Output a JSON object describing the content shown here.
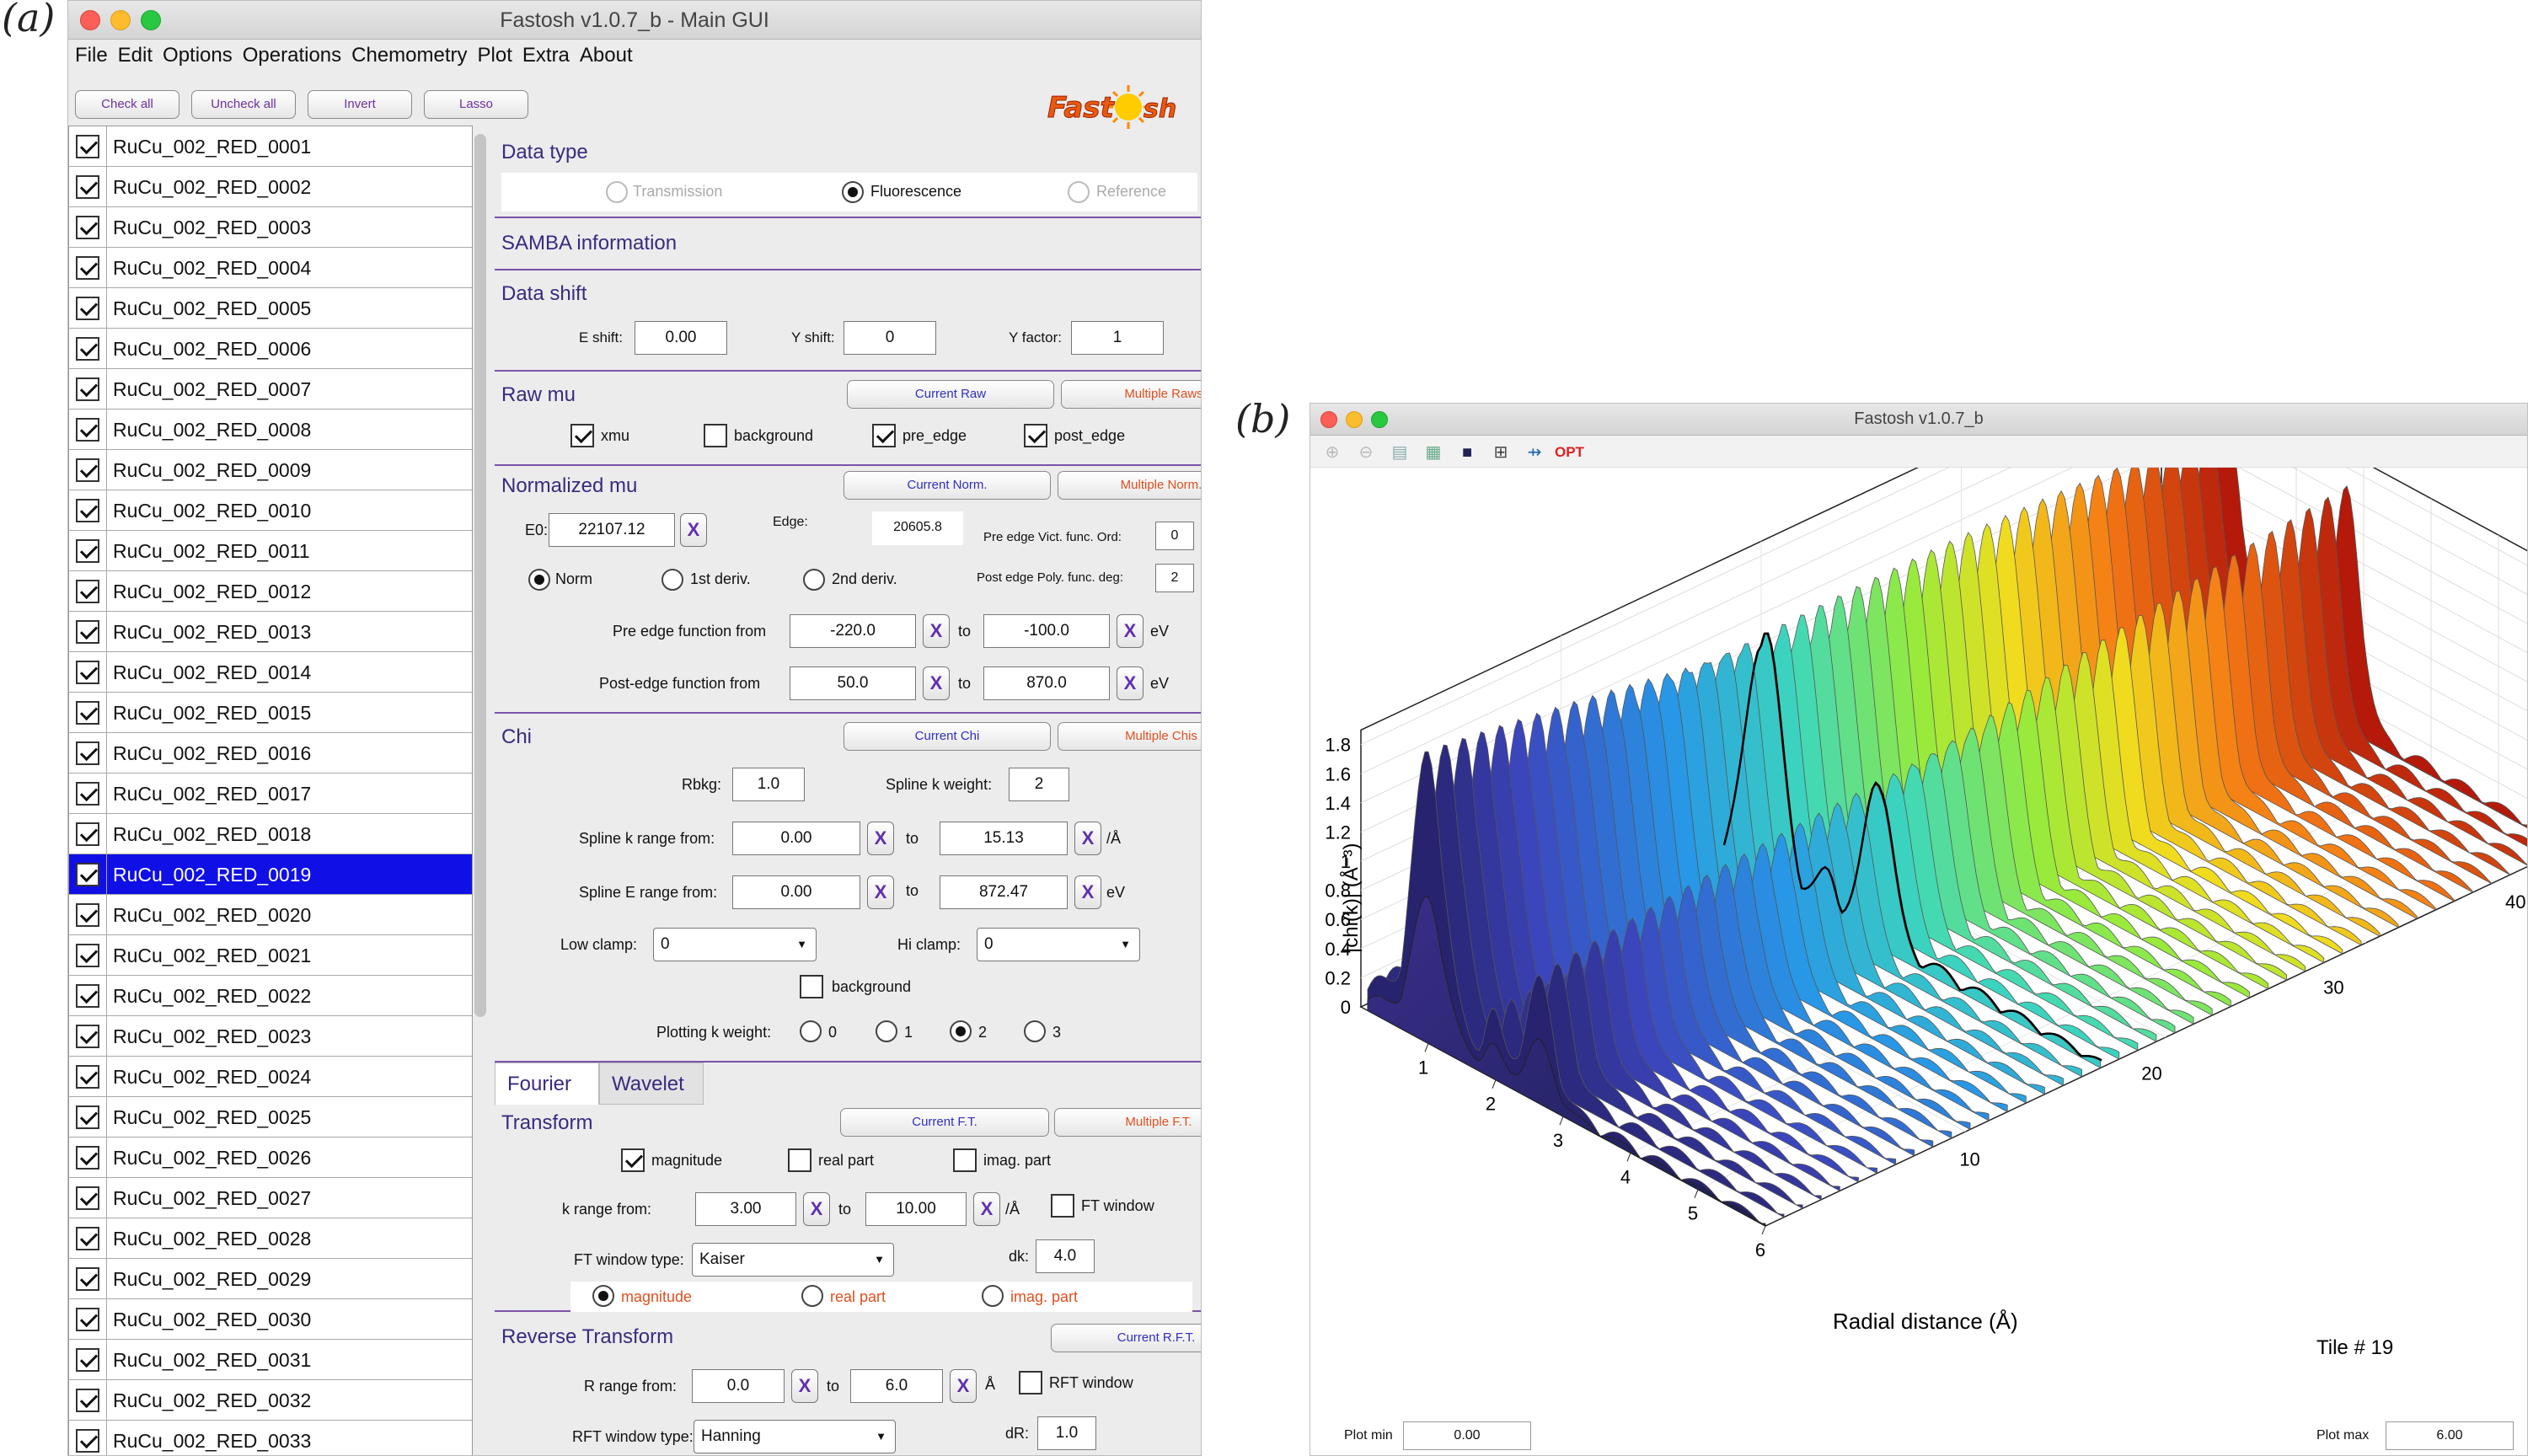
{
  "labels": {
    "a": "(a)",
    "b": "(b)"
  },
  "main": {
    "title": "Fastosh v1.0.7_b - Main GUI",
    "menu": [
      "File",
      "Edit",
      "Options",
      "Operations",
      "Chemometry",
      "Plot",
      "Extra",
      "About"
    ],
    "buttons": {
      "check_all": "Check all",
      "uncheck_all": "Uncheck all",
      "invert": "Invert",
      "lasso": "Lasso"
    },
    "logo": "Fastosh",
    "files": [
      "RuCu_002_RED_0001",
      "RuCu_002_RED_0002",
      "RuCu_002_RED_0003",
      "RuCu_002_RED_0004",
      "RuCu_002_RED_0005",
      "RuCu_002_RED_0006",
      "RuCu_002_RED_0007",
      "RuCu_002_RED_0008",
      "RuCu_002_RED_0009",
      "RuCu_002_RED_0010",
      "RuCu_002_RED_0011",
      "RuCu_002_RED_0012",
      "RuCu_002_RED_0013",
      "RuCu_002_RED_0014",
      "RuCu_002_RED_0015",
      "RuCu_002_RED_0016",
      "RuCu_002_RED_0017",
      "RuCu_002_RED_0018",
      "RuCu_002_RED_0019",
      "RuCu_002_RED_0020",
      "RuCu_002_RED_0021",
      "RuCu_002_RED_0022",
      "RuCu_002_RED_0023",
      "RuCu_002_RED_0024",
      "RuCu_002_RED_0025",
      "RuCu_002_RED_0026",
      "RuCu_002_RED_0027",
      "RuCu_002_RED_0028",
      "RuCu_002_RED_0029",
      "RuCu_002_RED_0030",
      "RuCu_002_RED_0031",
      "RuCu_002_RED_0032",
      "RuCu_002_RED_0033"
    ],
    "selected_file": "RuCu_002_RED_0019",
    "data_type": {
      "title": "Data type",
      "transmission": "Transmission",
      "fluorescence": "Fluorescence",
      "reference": "Reference",
      "selected": "Fluorescence"
    },
    "samba": {
      "title": "SAMBA information"
    },
    "data_shift": {
      "title": "Data shift",
      "e_shift_label": "E shift:",
      "e_shift": "0.00",
      "y_shift_label": "Y shift:",
      "y_shift": "0",
      "y_factor_label": "Y factor:",
      "y_factor": "1"
    },
    "raw_mu": {
      "title": "Raw mu",
      "current": "Current Raw",
      "multiple": "Multiple Raws",
      "xmu": "xmu",
      "background": "background",
      "pre_edge": "pre_edge",
      "post_edge": "post_edge"
    },
    "norm_mu": {
      "title": "Normalized mu",
      "current": "Current Norm.",
      "multiple": "Multiple Norm.",
      "e0_label": "E0:",
      "e0": "22107.12",
      "x": "X",
      "edge_label": "Edge:",
      "edge": "20605.8",
      "pre_ord_label": "Pre edge Vict. func. Ord:",
      "pre_ord": "0",
      "post_deg_label": "Post edge Poly. func. deg:",
      "post_deg": "2",
      "norm": "Norm",
      "d1": "1st deriv.",
      "d2": "2nd deriv.",
      "pre_label": "Pre edge function from",
      "pre_from": "-220.0",
      "to": "to",
      "pre_to": "-100.0",
      "ev": "eV",
      "post_label": "Post-edge function from",
      "post_from": "50.0",
      "post_to": "870.0"
    },
    "chi": {
      "title": "Chi",
      "current": "Current Chi",
      "multiple": "Multiple Chis",
      "rbkg_label": "Rbkg:",
      "rbkg": "1.0",
      "spline_kw_label": "Spline k weight:",
      "spline_kw": "2",
      "spline_k_label": "Spline k range from:",
      "spline_k_from": "0.00",
      "spline_k_to": "15.13",
      "per_a": "/Å",
      "spline_e_label": "Spline E range from:",
      "spline_e_from": "0.00",
      "spline_e_to": "872.47",
      "low_clamp_label": "Low clamp:",
      "low_clamp": "0",
      "hi_clamp_label": "Hi clamp:",
      "hi_clamp": "0",
      "background": "background",
      "plot_kw_label": "Plotting k weight:",
      "kw0": "0",
      "kw1": "1",
      "kw2": "2",
      "kw3": "3"
    },
    "tabs": {
      "fourier": "Fourier",
      "wavelet": "Wavelet"
    },
    "transform": {
      "title": "Transform",
      "current": "Current F.T.",
      "multiple": "Multiple F.T.",
      "magnitude": "magnitude",
      "real": "real part",
      "imag": "imag. part",
      "k_label": "k range from:",
      "k_from": "3.00",
      "k_to": "10.00",
      "ft_window": "FT window",
      "ft_type_label": "FT window type:",
      "ft_type": "Kaiser",
      "dk_label": "dk:",
      "dk": "4.0",
      "r_magnitude": "magnitude",
      "r_real": "real part",
      "r_imag": "imag. part"
    },
    "reverse": {
      "title": "Reverse Transform",
      "current": "Current R.F.T.",
      "r_label": "R range from:",
      "r_from": "0.0",
      "r_to": "6.0",
      "a": "Å",
      "rft_window": "RFT window",
      "rft_type_label": "RFT window type:",
      "rft_type": "Hanning",
      "dr_label": "dR:",
      "dr": "1.0"
    }
  },
  "plot_window": {
    "title": "Fastosh v1.0.7_b",
    "opt": "OPT",
    "tile": "Tile # 19",
    "plot_min_label": "Plot min",
    "plot_min": "0.00",
    "plot_max_label": "Plot max",
    "plot_max": "6.00",
    "colors": {
      "low": "#2b2a7a",
      "mid": "#3fd6a0",
      "high": "#b81e0e"
    }
  },
  "chart_data": {
    "type": "surface",
    "xlabel": "Radial distance (Å)",
    "ylabel": "|chi(k)|  (Å⁻³)",
    "x_ticks": [
      "1",
      "2",
      "3",
      "4",
      "5",
      "6"
    ],
    "y_ticks": [
      "0",
      "0.2",
      "0.4",
      "0.6",
      "0.8",
      "1",
      "1.2",
      "1.4",
      "1.6",
      "1.8"
    ],
    "z_ticks": [
      "10",
      "20",
      "30",
      "40"
    ],
    "xlim": [
      0,
      6
    ],
    "ylim": [
      0,
      1.9
    ],
    "zlim": [
      1,
      45
    ],
    "series_peaks": {
      "r": [
        1.0,
        1.95,
        2.65
      ],
      "first_peak_height": [
        1.82,
        1.45
      ],
      "second_peak_height": [
        0.75,
        1.55
      ]
    }
  }
}
